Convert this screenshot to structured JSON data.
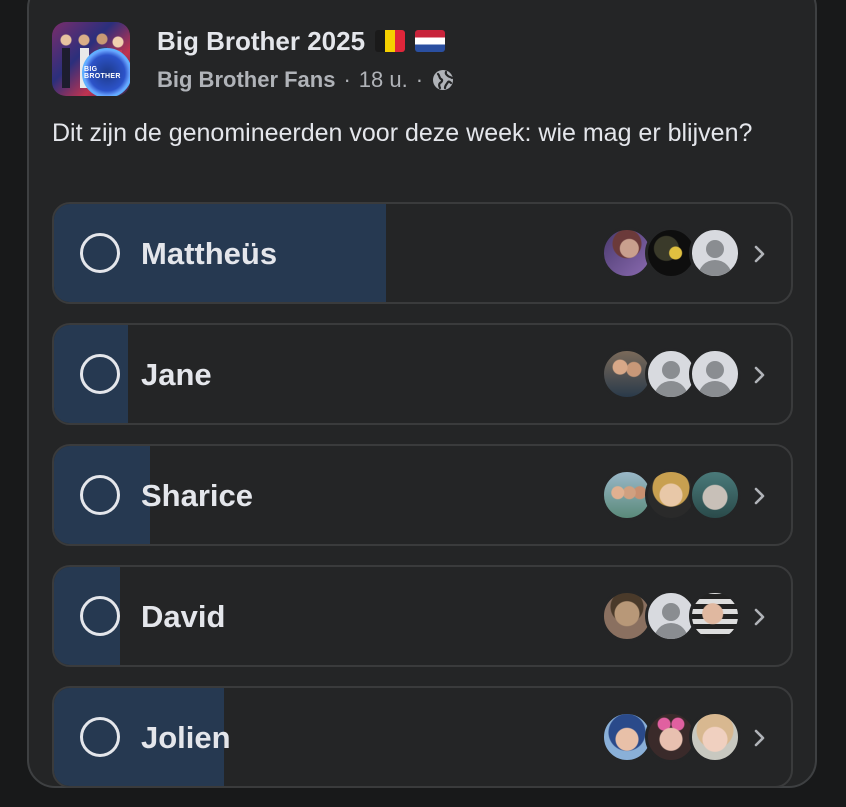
{
  "post": {
    "group_name": "Big Brother 2025",
    "flags": [
      "belgium-flag",
      "netherlands-flag"
    ],
    "author": "Big Brother Fans",
    "separator": "·",
    "time": "18 u.",
    "privacy_icon": "globe-icon",
    "logo_text": "BIG BROTHER",
    "text": "Dit zijn de genomineerden voor deze week: wie mag er blijven?"
  },
  "poll": {
    "options": [
      {
        "label": "Mattheüs",
        "share": 0.45,
        "voters": [
          "photo-purple",
          "photo-dark",
          "default"
        ]
      },
      {
        "label": "Jane",
        "share": 0.1,
        "voters": [
          "photo-group",
          "default",
          "default"
        ]
      },
      {
        "label": "Sharice",
        "share": 0.13,
        "voters": [
          "photo-group2",
          "photo-blonde",
          "photo-teal"
        ]
      },
      {
        "label": "David",
        "share": 0.09,
        "voters": [
          "photo-sepia",
          "default",
          "photo-selfie"
        ]
      },
      {
        "label": "Jolien",
        "share": 0.23,
        "voters": [
          "photo-blue",
          "photo-pink",
          "photo-glasses"
        ]
      }
    ]
  },
  "colors": {
    "background": "#18191a",
    "card": "#242526",
    "fill": "#263951",
    "text": "#e4e6eb",
    "secondary_text": "#b0b3b8"
  }
}
